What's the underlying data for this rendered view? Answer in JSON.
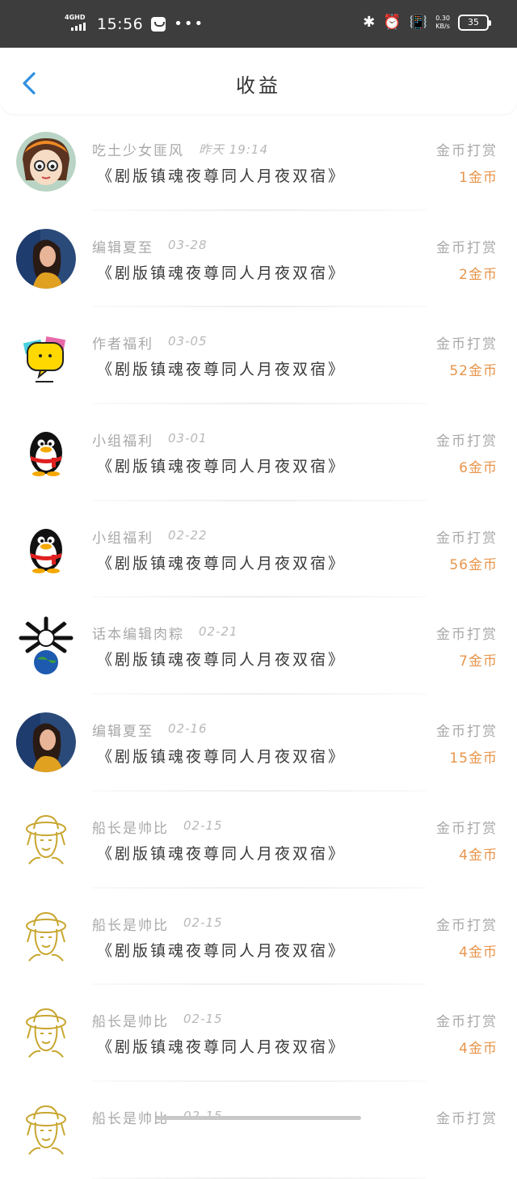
{
  "status_bar": {
    "network": "4GHD",
    "time": "15:56",
    "speed_value": "0.30",
    "speed_unit": "KB/s",
    "battery": "35"
  },
  "header": {
    "title": "收益",
    "back_icon": "chevron-left-icon",
    "accent_color": "#2f8fe0"
  },
  "colors": {
    "amount": "#e8954b",
    "meta": "#a8a8a8",
    "work": "#3a3a3a"
  },
  "rows": [
    {
      "name": "吃土少女匪风",
      "time": "昨天 19:14",
      "work": "《剧版镇魂夜尊同人月夜双宿》",
      "type": "金币打赏",
      "amount": "1金币",
      "avatar": "anime-girl-avatar"
    },
    {
      "name": "编辑夏至",
      "time": "03-28",
      "work": "《剧版镇魂夜尊同人月夜双宿》",
      "type": "金币打赏",
      "amount": "2金币",
      "avatar": "woman-photo-avatar"
    },
    {
      "name": "作者福利",
      "time": "03-05",
      "work": "《剧版镇魂夜尊同人月夜双宿》",
      "type": "金币打赏",
      "amount": "52金币",
      "avatar": "yellow-chat-avatar"
    },
    {
      "name": "小组福利",
      "time": "03-01",
      "work": "《剧版镇魂夜尊同人月夜双宿》",
      "type": "金币打赏",
      "amount": "6金币",
      "avatar": "penguin-avatar"
    },
    {
      "name": "小组福利",
      "time": "02-22",
      "work": "《剧版镇魂夜尊同人月夜双宿》",
      "type": "金币打赏",
      "amount": "56金币",
      "avatar": "penguin-avatar"
    },
    {
      "name": "话本编辑肉粽",
      "time": "02-21",
      "work": "《剧版镇魂夜尊同人月夜双宿》",
      "type": "金币打赏",
      "amount": "7金币",
      "avatar": "globe-bones-avatar"
    },
    {
      "name": "编辑夏至",
      "time": "02-16",
      "work": "《剧版镇魂夜尊同人月夜双宿》",
      "type": "金币打赏",
      "amount": "15金币",
      "avatar": "woman-photo-avatar"
    },
    {
      "name": "船长是帅比",
      "time": "02-15",
      "work": "《剧版镇魂夜尊同人月夜双宿》",
      "type": "金币打赏",
      "amount": "4金币",
      "avatar": "straw-hat-sketch-avatar"
    },
    {
      "name": "船长是帅比",
      "time": "02-15",
      "work": "《剧版镇魂夜尊同人月夜双宿》",
      "type": "金币打赏",
      "amount": "4金币",
      "avatar": "straw-hat-sketch-avatar"
    },
    {
      "name": "船长是帅比",
      "time": "02-15",
      "work": "《剧版镇魂夜尊同人月夜双宿》",
      "type": "金币打赏",
      "amount": "4金币",
      "avatar": "straw-hat-sketch-avatar"
    },
    {
      "name": "船长是帅比",
      "time": "02-15",
      "work": "",
      "type": "金币打赏",
      "amount": "",
      "avatar": "straw-hat-sketch-avatar"
    }
  ]
}
